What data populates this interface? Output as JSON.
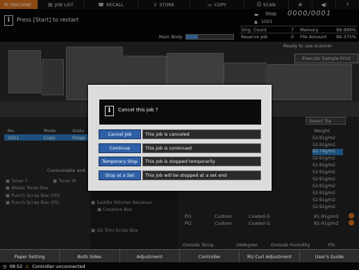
{
  "top_tabs": [
    {
      "icon": "✉",
      "label": "MACHINE"
    },
    {
      "icon": "▤",
      "label": "JOB LIST"
    },
    {
      "icon": "☎",
      "label": "RECALL"
    },
    {
      "icon": "⇩",
      "label": "STORE"
    },
    {
      "icon": "▭",
      "label": "COPY"
    },
    {
      "icon": "⎙",
      "label": "SCAN"
    },
    {
      "icon": "⊕",
      "label": ""
    },
    {
      "icon": "◀)",
      "label": ""
    },
    {
      "icon": "?",
      "label": ""
    }
  ],
  "header": {
    "message": "Press [Start] to restart",
    "main_body_label": "Main Body",
    "main_body_progress": 0.25
  },
  "status": {
    "stop_label": "Stop",
    "counter": "0000/0001",
    "user": "1021",
    "orig_count_label": "Orig. Count",
    "orig_count": "7",
    "memory_label": "Memory",
    "memory": "99.999%",
    "reserve_job_label": "Reserve Job",
    "reserve_job": "0",
    "file_amount_label": "File Amount",
    "file_amount": "99.375%"
  },
  "machine": {
    "ready": "Ready to use scanner",
    "sample_print": "Execute Sample Print"
  },
  "job_table": {
    "headers": [
      "No.",
      "Mode",
      "Statu"
    ],
    "row": [
      "1021",
      "Copy",
      "Stopp"
    ]
  },
  "consumables": {
    "title": "Consumable and",
    "items": [
      "Toner Y",
      "Toner M",
      "Waste Toner Box",
      "Punch Scrap Box (FD)",
      "Punch Scrap Box (FS)"
    ],
    "mid_items": [
      "Saddle Stitcher Receiver",
      "Creatore Box",
      "SD Trim Scrap Box"
    ]
  },
  "right": {
    "tray_select": "Select Tra",
    "weight_header": "Weight",
    "weights": [
      "52-91g/m2",
      "52-91g/m2",
      "62-74g/m2",
      "52-91g/m2",
      "52-91g/m2",
      "52-91g/m2",
      "52-91g/m2",
      "52-91g/m2",
      "52-91g/m2",
      "52-91g/m2",
      "52-91g/m2"
    ],
    "pi_rows": [
      [
        "PI1",
        "Custom",
        "Coated-G",
        "81-91g/m2"
      ],
      [
        "PI2",
        "Custom",
        "Coated-G",
        "81-91g/m2"
      ]
    ],
    "outside_temp_label": "Outside Temp.",
    "outside_temp": "26degree",
    "outside_humidity_label": "Outside Humidity",
    "outside_humidity": "0%"
  },
  "dialog": {
    "title": "Cancel this job ?",
    "options": [
      {
        "button": "Cancel Job",
        "desc": "This job is canceled"
      },
      {
        "button": "Continue",
        "desc": "This job is continued"
      },
      {
        "button": "Temporary Stop",
        "desc": "This job is stopped temporarily"
      },
      {
        "button": "Stop at a Set",
        "desc": "This job will be stopped at a set end"
      }
    ]
  },
  "bottom_tabs": [
    "Paper Setting",
    "Both Sides",
    "Adjustment",
    "Controller",
    "RU Curl Adjustment",
    "User's Guide"
  ],
  "statusbar": {
    "time": "08:52",
    "message": "Controller unconnected"
  }
}
